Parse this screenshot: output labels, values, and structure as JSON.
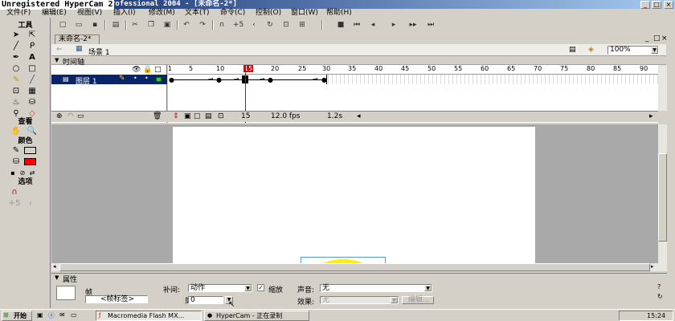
{
  "window": {
    "title": "rofessional 2004 - [未命名-2*]",
    "hypercam_label": "Unregistered HyperCam 2",
    "controls": [
      "_",
      "□",
      "×"
    ]
  },
  "menu": [
    "文件(F)",
    "编辑(E)",
    "视图(V)",
    "插入(I)",
    "修改(M)",
    "文本(T)",
    "命令(C)",
    "控制(O)",
    "窗口(W)",
    "帮助(H)"
  ],
  "tools_panel": {
    "tools_header": "工具",
    "view_header": "查看",
    "colors_header": "颜色",
    "options_header": "选项",
    "stroke_color": "#000000",
    "fill_color": "#ff0000"
  },
  "document": {
    "tab": "未命名-2*",
    "scene": "场景 1",
    "zoom": "100%"
  },
  "timeline": {
    "header": "时间轴",
    "layer_name": "图层 1",
    "ruler": [
      "1",
      "5",
      "10",
      "15",
      "20",
      "25",
      "30",
      "35",
      "40",
      "45",
      "50",
      "55",
      "60",
      "65",
      "70",
      "75",
      "80",
      "85",
      "90"
    ],
    "current_frame": "15",
    "frame_rate": "12.0 fps",
    "elapsed": "1.2s",
    "playhead_frame": 15
  },
  "properties": {
    "header": "属性",
    "frame_label": "帧",
    "frame_name_placeholder": "<帧标签>",
    "tween_label": "补间:",
    "tween_value": "动作",
    "scale_label": "缩放",
    "scale_checked": true,
    "ease_label": "简易:",
    "ease_value": "0",
    "sound_label": "声音:",
    "sound_value": "无",
    "effect_label": "效果:",
    "effect_value": "无",
    "edit_button": "编辑..."
  },
  "taskbar": {
    "start": "开始",
    "tasks": [
      "Macromedia Flash MX...",
      "HyperCam - 正在录制"
    ],
    "clock": "15:24"
  },
  "stage": {
    "ball_color": "#ffee00"
  }
}
